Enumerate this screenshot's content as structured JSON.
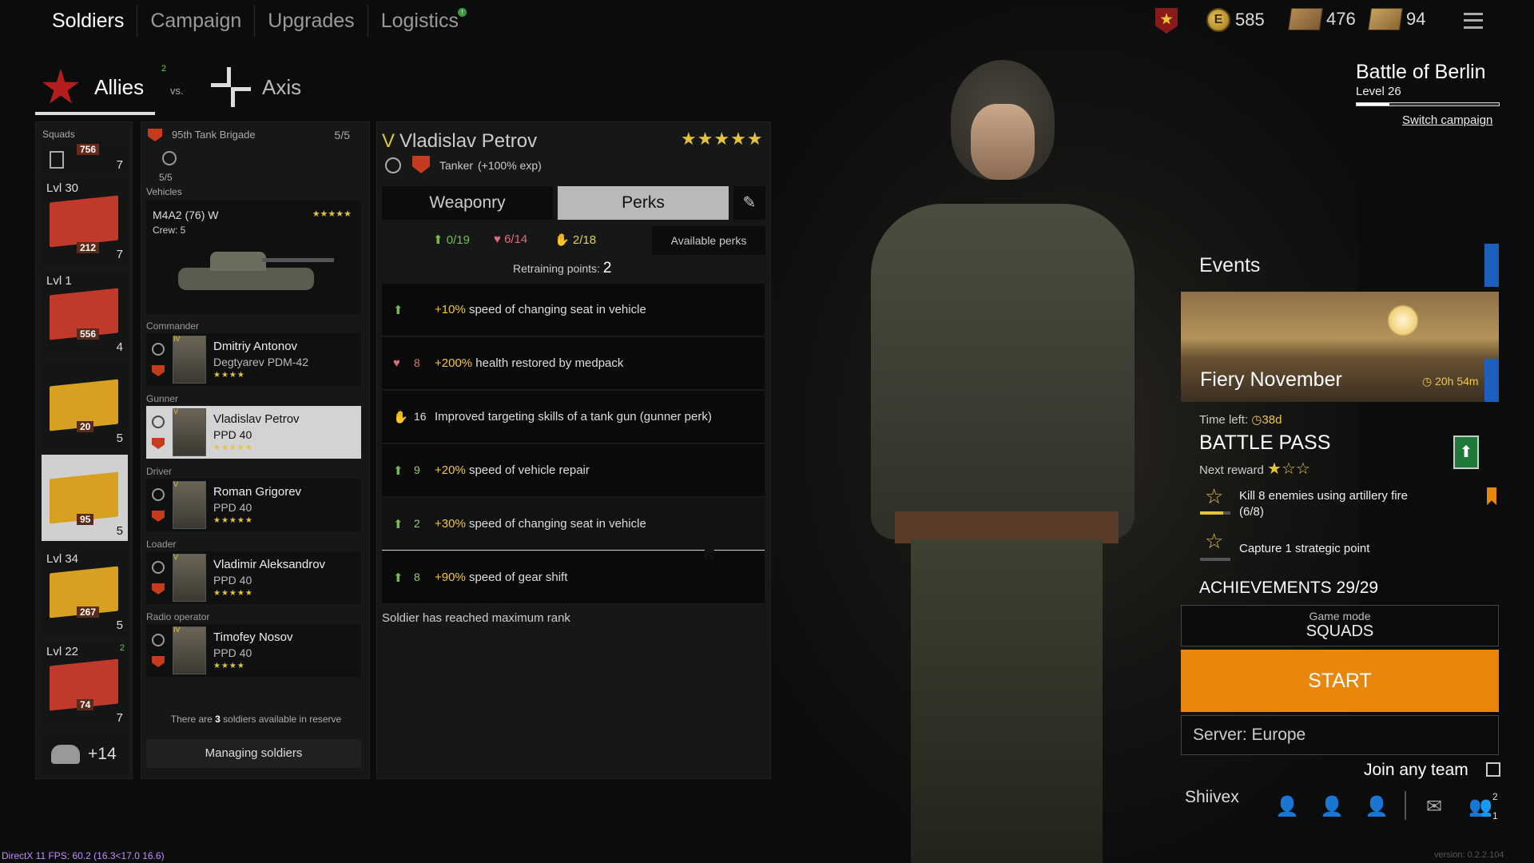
{
  "nav": {
    "tabs": [
      "Soldiers",
      "Campaign",
      "Upgrades",
      "Logistics"
    ],
    "logistics_badge": "!"
  },
  "currency": {
    "coin_symbol": "E",
    "coins": "585",
    "tickets_a": "476",
    "tickets_b": "94"
  },
  "faction": {
    "allies": "Allies",
    "vs": "vs.",
    "axis": "Axis",
    "allies_badge": "2"
  },
  "campaign": {
    "name": "Battle of Berlin",
    "level": "Level 26",
    "switch": "Switch campaign",
    "progress_fraction": 0.23
  },
  "squads": {
    "header": "Squads",
    "cards": [
      {
        "lvl": "",
        "num": "756",
        "count": "7"
      },
      {
        "lvl": "Lvl 30",
        "num": "212",
        "count": "7"
      },
      {
        "lvl": "Lvl 1",
        "num": "556",
        "count": "4"
      },
      {
        "lvl": "",
        "num": "20",
        "count": "5"
      },
      {
        "lvl": "",
        "num": "95",
        "count": "5"
      },
      {
        "lvl": "Lvl 34",
        "num": "267",
        "count": "5"
      },
      {
        "lvl": "Lvl 22",
        "num": "74",
        "count": "7",
        "badge": "2"
      }
    ],
    "more": "+14"
  },
  "brigade": {
    "name": "95th Tank Brigade",
    "capacity": "5/5",
    "vehicle_count": "5/5",
    "vehicles_label": "Vehicles",
    "vehicle_name": "M4A2 (76) W",
    "crew": "Crew: 5",
    "roles": [
      "Commander",
      "Gunner",
      "Driver",
      "Loader",
      "Radio operator"
    ],
    "soldiers": [
      {
        "rank": "IV",
        "name": "Dmitriy Antonov",
        "weapon": "Degtyarev PDM-42",
        "stars": "★★★★"
      },
      {
        "rank": "V",
        "name": "Vladislav Petrov",
        "weapon": "PPD 40",
        "stars": "★★★★★"
      },
      {
        "rank": "V",
        "name": "Roman Grigorev",
        "weapon": "PPD 40",
        "stars": "★★★★★"
      },
      {
        "rank": "V",
        "name": "Vladimir Aleksandrov",
        "weapon": "PPD 40",
        "stars": "★★★★★"
      },
      {
        "rank": "IV",
        "name": "Timofey Nosov",
        "weapon": "PPD 40",
        "stars": "★★★★"
      }
    ],
    "reserve_pre": "There are ",
    "reserve_count": "3",
    "reserve_post": " soldiers available in reserve",
    "manage": "Managing soldiers"
  },
  "soldier": {
    "rank": "V",
    "name": "Vladislav Petrov",
    "stars": "★★★★★",
    "class": "Tanker",
    "bonus": "(+100% exp)",
    "tab_weaponry": "Weaponry",
    "tab_perks": "Perks",
    "stat_a": "0/19",
    "stat_b": "6/14",
    "stat_c": "2/18",
    "available_perks": "Available perks",
    "retraining_label": "Retraining points:",
    "retraining_value": "2",
    "perks": [
      {
        "cost": "",
        "highlight": "+10%",
        "text": " speed of changing seat in vehicle",
        "type": "g"
      },
      {
        "cost": "8",
        "highlight": "+200%",
        "text": " health restored by medpack",
        "type": "p"
      },
      {
        "cost": "16",
        "highlight": "",
        "text": "Improved targeting skills of a tank gun (gunner perk)",
        "type": "y"
      },
      {
        "cost": "9",
        "highlight": "+20%",
        "text": " speed of vehicle repair",
        "type": "g"
      },
      {
        "cost": "2",
        "highlight": "+30%",
        "text": " speed of changing seat in vehicle",
        "type": "g"
      },
      {
        "cost": "8",
        "highlight": "+90%",
        "text": " speed of gear shift",
        "type": "g"
      }
    ],
    "max_rank": "Soldier has reached maximum rank"
  },
  "events": {
    "title": "Events",
    "event_name": "Fiery November",
    "event_time": "20h 54m",
    "time_left_label": "Time left:",
    "time_left": "38d",
    "battle_pass": "BATTLE PASS",
    "next_reward": "Next reward",
    "reward_stars": "★☆☆",
    "task1": "Kill 8 enemies using artillery fire",
    "task1_progress": "(6/8)",
    "task1_fraction": 0.75,
    "task2": "Capture 1 strategic point",
    "task2_fraction": 0.0,
    "achievements": "ACHIEVEMENTS 29/29"
  },
  "play": {
    "mode_label": "Game mode",
    "mode": "SQUADS",
    "start": "START",
    "server": "Server: Europe",
    "join_any": "Join any team",
    "username": "Shiivex",
    "friends_count_a": "2",
    "friends_count_b": "1"
  },
  "footer": {
    "fps": "DirectX 11 FPS: 60.2 (16.3<17.0 16.6)",
    "version": "version: 0.2.2.104"
  },
  "colors": {
    "accent_orange": "#e8870b",
    "star_gold": "#e5c33a",
    "brand_red": "#b51d1d",
    "events_blue": "#1d5fbf"
  }
}
